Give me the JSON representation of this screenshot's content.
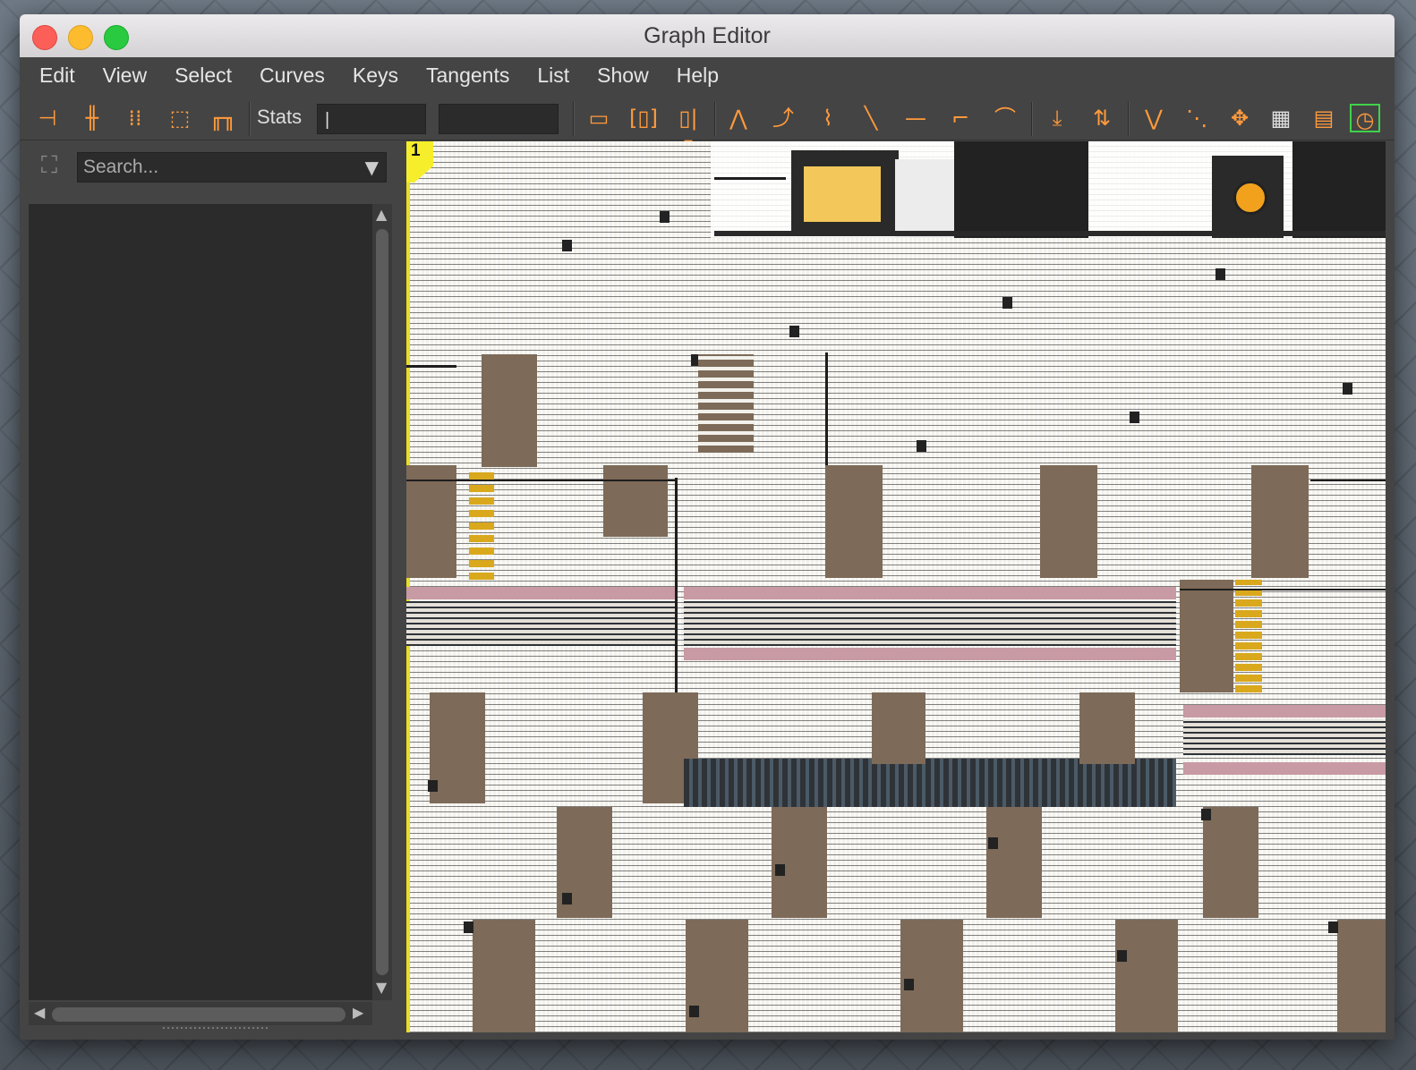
{
  "window": {
    "title": "Graph Editor"
  },
  "menu": {
    "items": [
      "Edit",
      "View",
      "Select",
      "Curves",
      "Keys",
      "Tangents",
      "List",
      "Show",
      "Help"
    ]
  },
  "toolbar": {
    "stats_label": "Stats",
    "stats_field_1": "|",
    "stats_field_2": "",
    "icons": [
      "move-key-icon",
      "insert-key-icon",
      "lattice-deform-icon",
      "region-tool-icon",
      "retime-tool-icon",
      "frame-all-icon",
      "frame-playback-range-icon",
      "center-current-time-icon",
      "auto-tangent-icon",
      "spline-tangent-icon",
      "clamped-tangent-icon",
      "linear-tangent-icon",
      "flat-tangent-icon",
      "step-tangent-icon",
      "plateau-tangent-icon",
      "buffer-curve-snapshot-icon",
      "swap-buffer-curves-icon",
      "break-tangents-icon",
      "unify-tangents-icon",
      "free-tangent-weight-icon",
      "lock-tangent-weight-icon",
      "normalize-icon",
      "time-editor-icon"
    ]
  },
  "outliner": {
    "search_placeholder": "Search..."
  },
  "graph": {
    "current_frame": "1",
    "colors": {
      "background": "#f2f1ec",
      "blocks": "#7d6a58",
      "bands": "#c89aa4",
      "current_time": "#f6ee2a"
    }
  }
}
